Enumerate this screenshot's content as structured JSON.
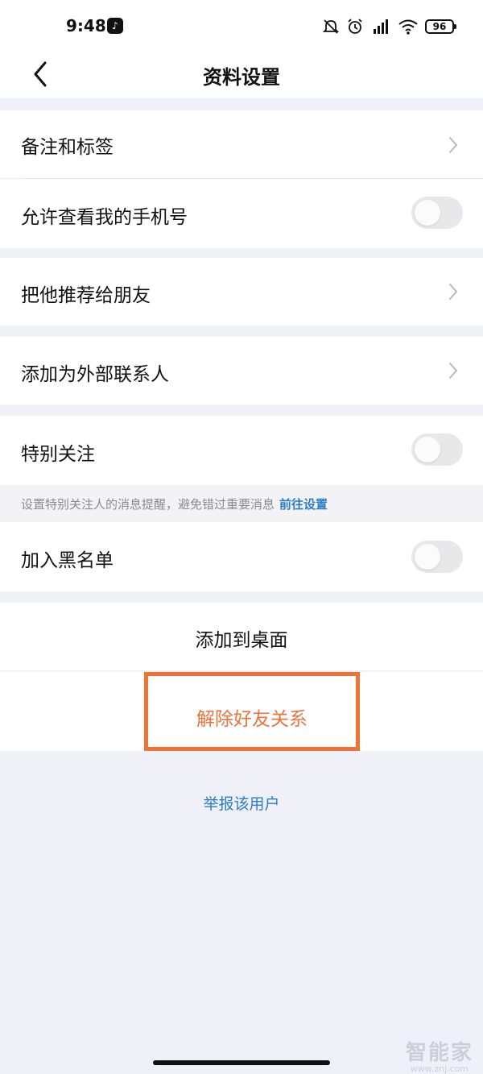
{
  "status_bar": {
    "time": "9:48",
    "battery": "96"
  },
  "header": {
    "title": "资料设置"
  },
  "settings": {
    "remarks_tags": "备注和标签",
    "allow_view_phone": "允许查看我的手机号",
    "recommend_friend": "把他推荐给朋友",
    "add_external_contact": "添加为外部联系人",
    "special_attention": "特别关注",
    "hint_text": "设置特别关注人的消息提醒，避免错过重要消息",
    "hint_link": "前往设置",
    "blacklist": "加入黑名单",
    "add_to_desktop": "添加到桌面",
    "remove_friend": "解除好友关系",
    "report_user": "举报该用户"
  },
  "toggles": {
    "allow_view_phone": false,
    "special_attention": false,
    "blacklist": false
  },
  "colors": {
    "link": "#2d7dc6",
    "danger": "#e8743b",
    "highlight": "#f07336",
    "background": "#f0f1f8"
  },
  "watermark": {
    "title": "智能家",
    "sub": "www.znj.com"
  }
}
